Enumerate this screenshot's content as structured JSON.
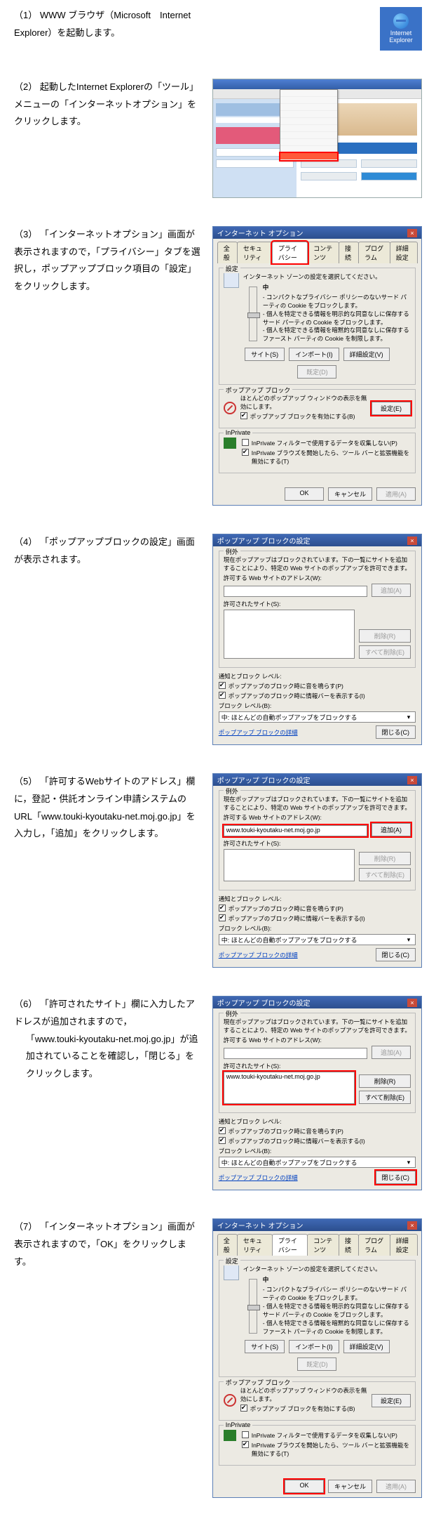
{
  "steps": {
    "s1": {
      "num": "（1）",
      "text": "WWW ブラウザ（Microsoft　Internet Explorer）を起動します。"
    },
    "s2": {
      "num": "（2）",
      "text": "起動したInternet Explorerの「ツール」メニューの「インターネットオプション」をクリックします。"
    },
    "s3": {
      "num": "（3）",
      "text": "「インターネットオプション」画面が表示されますので，「プライバシー」タブを選択し，ポップアップブロック項目の「設定」をクリックします。"
    },
    "s4": {
      "num": "（4）",
      "text": "「ポップアップブロックの設定」画面が表示されます。"
    },
    "s5": {
      "num": "（5）",
      "text": "「許可するWebサイトのアドレス」欄に，登記・供託オンライン申請システムのURL「www.touki-kyoutaku-net.moj.go.jp」を入力し，「追加」をクリックします。"
    },
    "s6": {
      "num": "（6）",
      "text": "「許可されたサイト」欄に入力したアドレスが追加されますので，",
      "text2": "「www.touki-kyoutaku-net.moj.go.jp」が追加されていることを確認し，「閉じる」をクリックします。"
    },
    "s7": {
      "num": "（7）",
      "text": "「インターネットオプション」画面が表示されますので，「OK」をクリックします。"
    }
  },
  "ie_icon": {
    "line1": "Internet",
    "line2": "Explorer"
  },
  "ioptions": {
    "title": "インターネット オプション",
    "tabs": {
      "t0": "全般",
      "t1": "セキュリティ",
      "t2": "プライバシー",
      "t3": "コンテンツ",
      "t4": "接続",
      "t5": "プログラム",
      "t6": "詳細設定"
    },
    "settings_group": "設定",
    "zone_msg": "インターネット ゾーンの設定を選択してください。",
    "level": "中",
    "level_desc": "- コンパクトなプライバシー ポリシーのないサード パーティの Cookie をブロックします。\n- 個人を特定できる情報を明示的な同意なしに保存するサード パーティの Cookie をブロックします。\n- 個人を特定できる情報を暗黙的な同意なしに保存するファースト パーティの Cookie を制限します。",
    "btn_sites": "サイト(S)",
    "btn_import": "インポート(I)",
    "btn_adv": "詳細設定(V)",
    "btn_default": "既定(D)",
    "popup_group": "ポップアップ ブロック",
    "popup_msg": "ほとんどのポップアップ ウィンドウの表示を無効にします。",
    "popup_chk": "ポップアップ ブロックを有効にする(B)",
    "btn_settings": "設定(E)",
    "inprivate_group": "InPrivate",
    "inprivate_chk1": "InPrivate フィルターで使用するデータを収集しない(P)",
    "inprivate_chk2": "InPrivate ブラウズを開始したら、ツール バーと拡張機能を無効にする(T)",
    "btn_ok": "OK",
    "btn_cancel": "キャンセル",
    "btn_apply": "適用(A)"
  },
  "pblock": {
    "title": "ポップアップ ブロックの設定",
    "exceptions": "例外",
    "exc_msg": "現在ポップアップはブロックされています。下の一覧にサイトを追加することにより、特定の Web サイトのポップアップを許可できます。",
    "addr_label": "許可する Web サイトのアドレス(W):",
    "addr_value": "www.touki-kyoutaku-net.moj.go.jp",
    "btn_add": "追加(A)",
    "allowed_label": "許可されたサイト(S):",
    "allowed_value": "www.touki-kyoutaku-net.moj.go.jp",
    "btn_remove": "削除(R)",
    "btn_remove_all": "すべて削除(E)",
    "notify_group": "通知とブロック レベル:",
    "notify_chk1": "ポップアップのブロック時に音を鳴らす(P)",
    "notify_chk2": "ポップアップのブロック時に情報バーを表示する(I)",
    "block_level_label": "ブロック レベル(B):",
    "block_level_value": "中: ほとんどの自動ポップアップをブロックする",
    "link": "ポップアップ ブロックの詳細",
    "btn_close": "閉じる(C)"
  }
}
